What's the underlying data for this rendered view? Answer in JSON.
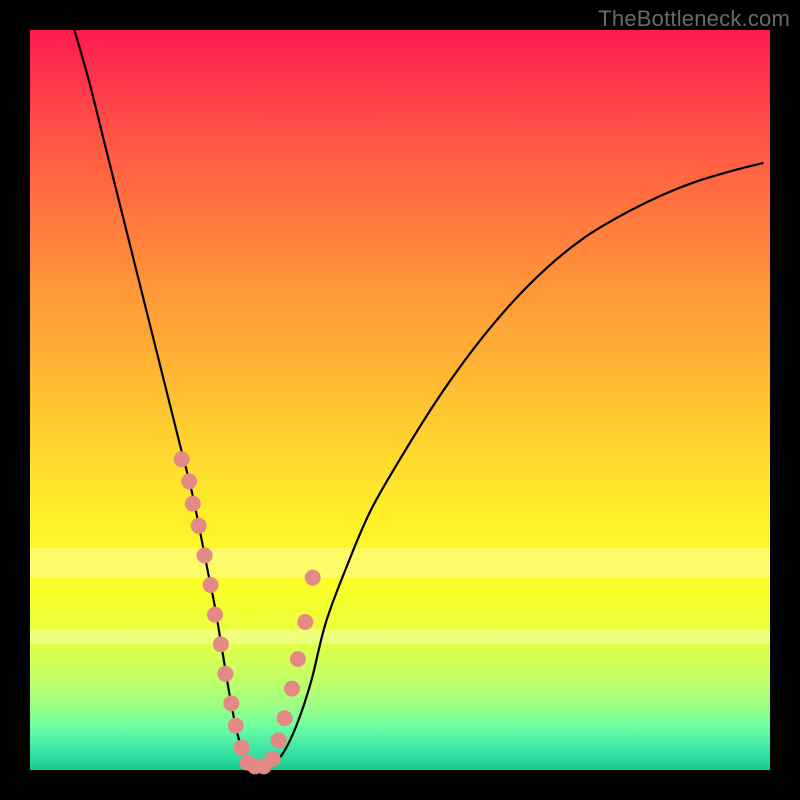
{
  "watermark": "TheBottleneck.com",
  "colors": {
    "frame": "#000000",
    "point": "#e38a86",
    "curve": "#000000",
    "gradient_top": "#ff1a50",
    "gradient_bottom": "#18c990"
  },
  "chart_data": {
    "type": "line",
    "title": "",
    "xlabel": "",
    "ylabel": "",
    "xlim": [
      0,
      100
    ],
    "ylim": [
      0,
      100
    ],
    "pale_bands_y": [
      [
        26,
        30
      ],
      [
        17,
        19
      ]
    ],
    "series": [
      {
        "name": "bottleneck-curve",
        "x": [
          6,
          8,
          10,
          12,
          14,
          16,
          18,
          20,
          22,
          24,
          25,
          26,
          27,
          28,
          29,
          30,
          32,
          34,
          36,
          38,
          40,
          43,
          46,
          50,
          55,
          60,
          65,
          70,
          75,
          80,
          85,
          90,
          95,
          99
        ],
        "y": [
          100,
          93,
          85,
          77,
          69,
          61,
          53,
          45,
          37,
          27,
          22,
          16,
          10,
          5,
          2,
          0.5,
          0.5,
          2,
          6,
          12,
          20,
          28,
          35,
          42,
          50,
          57,
          63,
          68,
          72,
          75,
          77.5,
          79.5,
          81,
          82
        ]
      }
    ],
    "points": {
      "name": "highlight-points",
      "x": [
        20.5,
        21.5,
        22.0,
        22.8,
        23.6,
        24.4,
        25.0,
        25.8,
        26.4,
        27.2,
        27.8,
        28.6,
        29.4,
        30.4,
        31.6,
        32.8,
        33.6,
        34.4,
        35.4,
        36.2,
        37.2,
        38.2
      ],
      "y": [
        42,
        39,
        36,
        33,
        29,
        25,
        21,
        17,
        13,
        9,
        6,
        3,
        1,
        0.5,
        0.5,
        1.5,
        4,
        7,
        11,
        15,
        20,
        26
      ]
    }
  }
}
